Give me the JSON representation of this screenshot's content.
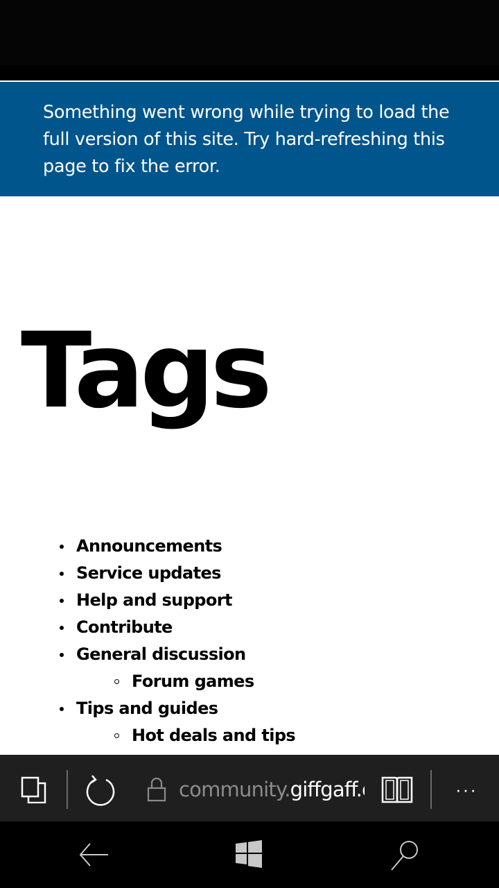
{
  "banner": {
    "message": "Something went wrong while trying to load the full version of this site. Try hard-refreshing this page to fix the error.",
    "background": "#00558c"
  },
  "page": {
    "title": "Tags"
  },
  "tags": [
    {
      "label": "Announcements",
      "level": 1
    },
    {
      "label": "Service updates",
      "level": 1
    },
    {
      "label": "Help and support",
      "level": 1
    },
    {
      "label": "Contribute",
      "level": 1
    },
    {
      "label": "General discussion",
      "level": 1
    },
    {
      "label": "Forum games",
      "level": 2
    },
    {
      "label": "Tips and guides",
      "level": 1
    },
    {
      "label": "Hot deals and tips",
      "level": 2
    }
  ],
  "browser_toolbar": {
    "tabs_icon": "tabs-icon",
    "refresh_icon": "refresh-icon",
    "lock_icon": "lock-icon",
    "url_subdomain": "community.",
    "url_domain": "giffgaff.c",
    "reading_view_icon": "reading-view-icon",
    "more_icon": "more-icon",
    "more_label": "···"
  },
  "system_nav": {
    "back_icon": "back-arrow-icon",
    "start_icon": "windows-start-icon",
    "search_icon": "search-icon"
  }
}
